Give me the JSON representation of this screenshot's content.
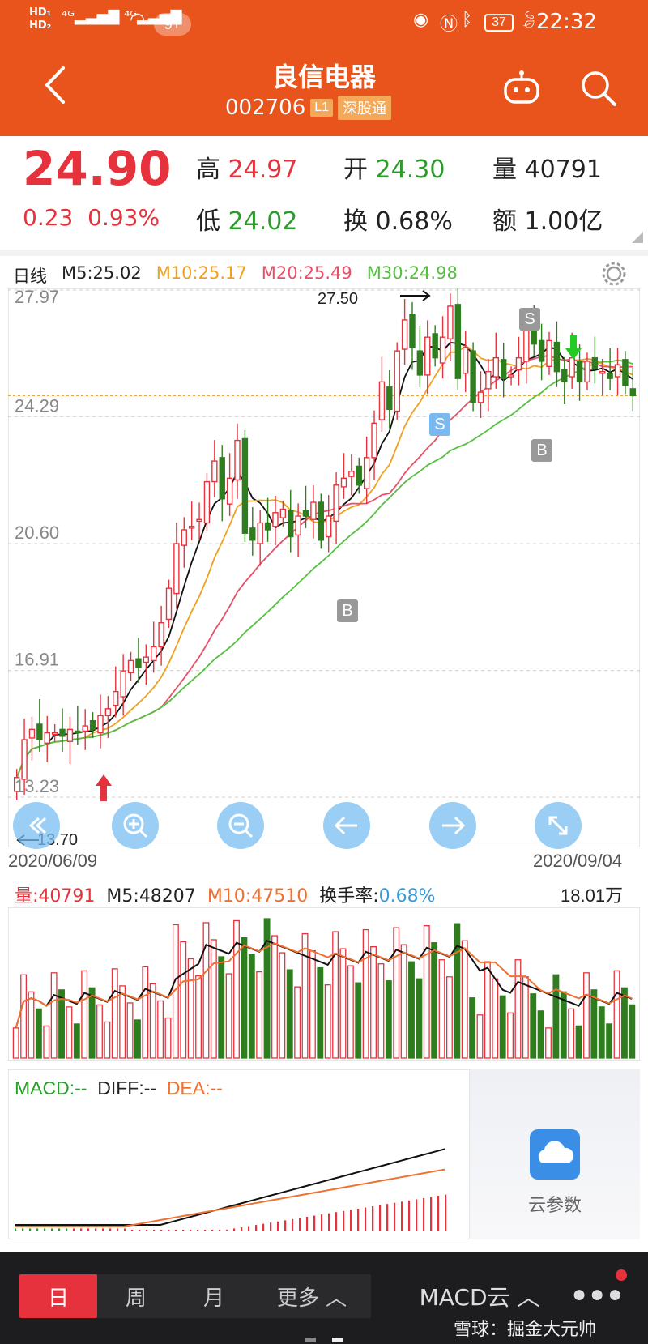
{
  "status_bar": {
    "network_left": "HD",
    "badge": "9+",
    "battery": "37",
    "time": "22:32"
  },
  "header": {
    "title": "良信电器",
    "code": "002706",
    "level_tag": "L1",
    "market_tag": "深股通"
  },
  "quote": {
    "price": "24.90",
    "change": "0.23",
    "change_pct": "0.93%",
    "high_label": "高",
    "high": "24.97",
    "low_label": "低",
    "low": "24.02",
    "open_label": "开",
    "open": "24.30",
    "turnover_label": "换",
    "turnover": "0.68%",
    "volume_label": "量",
    "volume": "40791",
    "amount_label": "额",
    "amount": "1.00亿"
  },
  "kline": {
    "period": "日线",
    "m5": "M5:25.02",
    "m10": "M10:25.17",
    "m20": "M20:25.49",
    "m30": "M30:24.98",
    "y_labels": [
      "27.97",
      "24.29",
      "20.60",
      "16.91",
      "13.23"
    ],
    "high_mark": "27.50",
    "low_mark": "13.70",
    "date_start": "2020/06/09",
    "date_end": "2020/09/04",
    "signal_s": "S",
    "signal_b": "B",
    "colors": {
      "up": "#e6323c",
      "down": "#2e7d1e",
      "m5": "#111111",
      "m10": "#f0a020",
      "m20": "#e8506a",
      "m30": "#55c040"
    }
  },
  "volume": {
    "label": "量:",
    "value": "40791",
    "m5": "M5:48207",
    "m10": "M10:47510",
    "turnover_label": "换手率:",
    "turnover": "0.68%",
    "max": "18.01万"
  },
  "macd": {
    "macd": "MACD:--",
    "diff": "DIFF:--",
    "dea": "DEA:--",
    "cloud_label": "云参数"
  },
  "bottom_tabs": {
    "day": "日",
    "week": "周",
    "month": "月",
    "more": "更多",
    "indicator": "MACD云"
  },
  "watermark": "雪球：掘金大元帅",
  "chart_data": {
    "type": "candlestick",
    "x_range": [
      "2020/06/09",
      "2020/09/04"
    ],
    "ylim": [
      13.23,
      27.97
    ],
    "y_ticks": [
      27.97,
      24.29,
      20.6,
      16.91,
      13.23
    ],
    "annotations": {
      "period_high": 27.5,
      "period_low": 13.7
    },
    "close_series": [
      13.8,
      14.9,
      15.2,
      14.9,
      15.1,
      15.1,
      15.0,
      15.2,
      15.1,
      15.3,
      15.2,
      15.6,
      15.8,
      16.3,
      16.9,
      17.2,
      17.0,
      17.3,
      17.6,
      18.3,
      19.3,
      20.6,
      21.0,
      21.1,
      21.3,
      22.4,
      23.0,
      21.9,
      22.5,
      23.6,
      20.9,
      20.7,
      21.2,
      21.0,
      21.5,
      21.6,
      20.8,
      21.4,
      21.4,
      21.8,
      20.7,
      21.4,
      22.3,
      22.5,
      22.7,
      22.3,
      23.1,
      24.1,
      25.3,
      24.5,
      26.2,
      27.1,
      26.3,
      25.5,
      26.6,
      26.0,
      26.6,
      27.5,
      25.4,
      26.3,
      24.7,
      25.0,
      25.6,
      26.0,
      25.4,
      25.5,
      26.0,
      26.8,
      26.4,
      25.9,
      26.5,
      25.6,
      25.3,
      26.0,
      25.3,
      25.9,
      25.7,
      25.6,
      25.4,
      25.8,
      25.2,
      24.9
    ]
  }
}
